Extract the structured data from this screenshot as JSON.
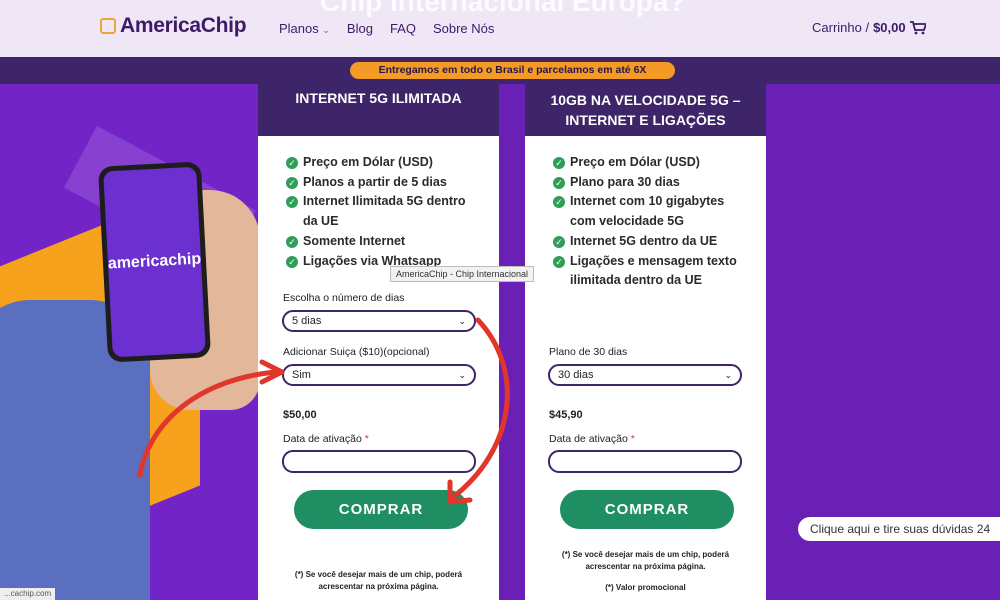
{
  "header": {
    "ghost_title": "Chip Internacional Europa?",
    "logo": "AmericaChip",
    "nav": [
      {
        "label": "Planos",
        "has_dropdown": true
      },
      {
        "label": "Blog"
      },
      {
        "label": "FAQ"
      },
      {
        "label": "Sobre Nós"
      }
    ],
    "cart_label": "Carrinho /",
    "cart_total": "$0,00"
  },
  "banner": {
    "text": "Entregamos em todo o Brasil e parcelamos em até 6X"
  },
  "phone": {
    "brand_text": "americachip"
  },
  "tooltip": {
    "text": "AmericaChip - Chip Internacional"
  },
  "plans": [
    {
      "title": "INTERNET 5G ILIMITADA",
      "features": [
        [
          "Preço em Dólar (USD)"
        ],
        [
          "Planos a partir de 5 dias"
        ],
        [
          "Internet Ilimitada 5G dentro",
          "da UE"
        ],
        [
          "Somente Internet"
        ],
        [
          "Ligações via Whatsapp"
        ]
      ],
      "days_label": "Escolha o número de dias",
      "days_value": "5 dias",
      "swiss_label": "Adicionar Suiça ($10)(opcional)",
      "swiss_value": "Sim",
      "price": "$50,00",
      "activation_label": "Data de ativação",
      "required_mark": "*",
      "buy_label": "COMPRAR",
      "note_line1": "(*) Se você desejar mais de um chip, poderá",
      "note_line2": "acrescentar na próxima página."
    },
    {
      "title_line1": "10GB NA VELOCIDADE 5G –",
      "title_line2": "INTERNET E LIGAÇÕES",
      "features": [
        [
          "Preço em Dólar (USD)"
        ],
        [
          "Plano para 30 dias"
        ],
        [
          "Internet com 10 gigabytes",
          "com velocidade 5G"
        ],
        [
          "Internet 5G dentro da UE"
        ],
        [
          "Ligações e mensagem texto",
          "ilimitada dentro da UE"
        ]
      ],
      "plan_label": "Plano de 30 dias",
      "plan_value": "30 dias",
      "price": "$45,90",
      "activation_label": "Data de ativação",
      "required_mark": "*",
      "buy_label": "COMPRAR",
      "note_line1": "(*) Se você desejar mais de um chip, poderá",
      "note_line2": "acrescentar na próxima página.",
      "promo_note": "(*) Valor promocional"
    }
  ],
  "help": {
    "text": "Clique aqui e tire suas dúvidas 24"
  },
  "status_url": "...cachip.com",
  "colors": {
    "purple": "#6a1fb5",
    "dark_purple": "#3e2468",
    "orange": "#f39b25",
    "green": "#1f8e62",
    "arrow_red": "#e0362c"
  }
}
